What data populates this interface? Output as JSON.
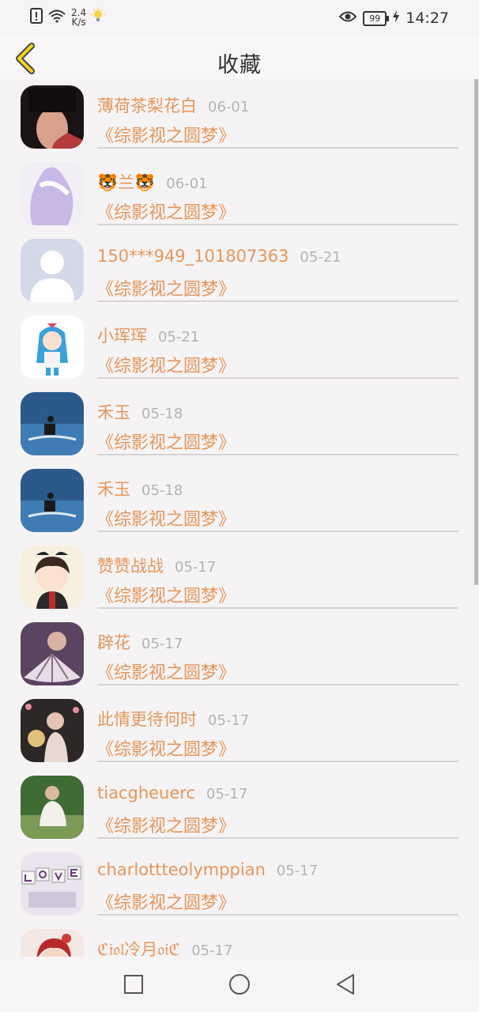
{
  "status_bar": {
    "speed_value": "2.4",
    "speed_unit": "K/s",
    "battery": "99",
    "time": "14:27"
  },
  "header": {
    "title": "收藏"
  },
  "items": [
    {
      "name": "薄荷茶梨花白",
      "date": "06-01",
      "story": "《综影视之圆梦》",
      "avatar": "woman-photo"
    },
    {
      "name": "🐯兰🐯",
      "date": "06-01",
      "story": "《综影视之圆梦》",
      "avatar": "lavender-dress"
    },
    {
      "name": "150***949_101807363",
      "date": "05-21",
      "story": "《综影视之圆梦》",
      "avatar": "default-person"
    },
    {
      "name": "小珲珲",
      "date": "05-21",
      "story": "《综影视之圆梦》",
      "avatar": "anime-girl"
    },
    {
      "name": "禾玉",
      "date": "05-18",
      "story": "《综影视之圆梦》",
      "avatar": "jetski-sea"
    },
    {
      "name": "禾玉",
      "date": "05-18",
      "story": "《综影视之圆梦》",
      "avatar": "jetski-sea"
    },
    {
      "name": "赞赞战战",
      "date": "05-17",
      "story": "《综影视之圆梦》",
      "avatar": "chibi-character"
    },
    {
      "name": "辟花",
      "date": "05-17",
      "story": "《综影视之圆梦》",
      "avatar": "fan-portrait"
    },
    {
      "name": "此情更待何时",
      "date": "05-17",
      "story": "《综影视之圆梦》",
      "avatar": "fan-woman-dark"
    },
    {
      "name": "tiacgheuerc",
      "date": "05-17",
      "story": "《综影视之圆梦》",
      "avatar": "forest-woman"
    },
    {
      "name": "charlottteolymppian",
      "date": "05-17",
      "story": "《综影视之圆梦》",
      "avatar": "love-letters"
    },
    {
      "name": "ℭ𝔦𝔬𝔩冷月𝔬𝔦ℭ",
      "date": "05-17",
      "story": "",
      "avatar": "red-hair-girl"
    }
  ],
  "colors": {
    "accent": "#e7965a",
    "date": "#b5b3b3",
    "background": "#f6f3f5",
    "back_arrow_fill": "#f5d21c"
  }
}
